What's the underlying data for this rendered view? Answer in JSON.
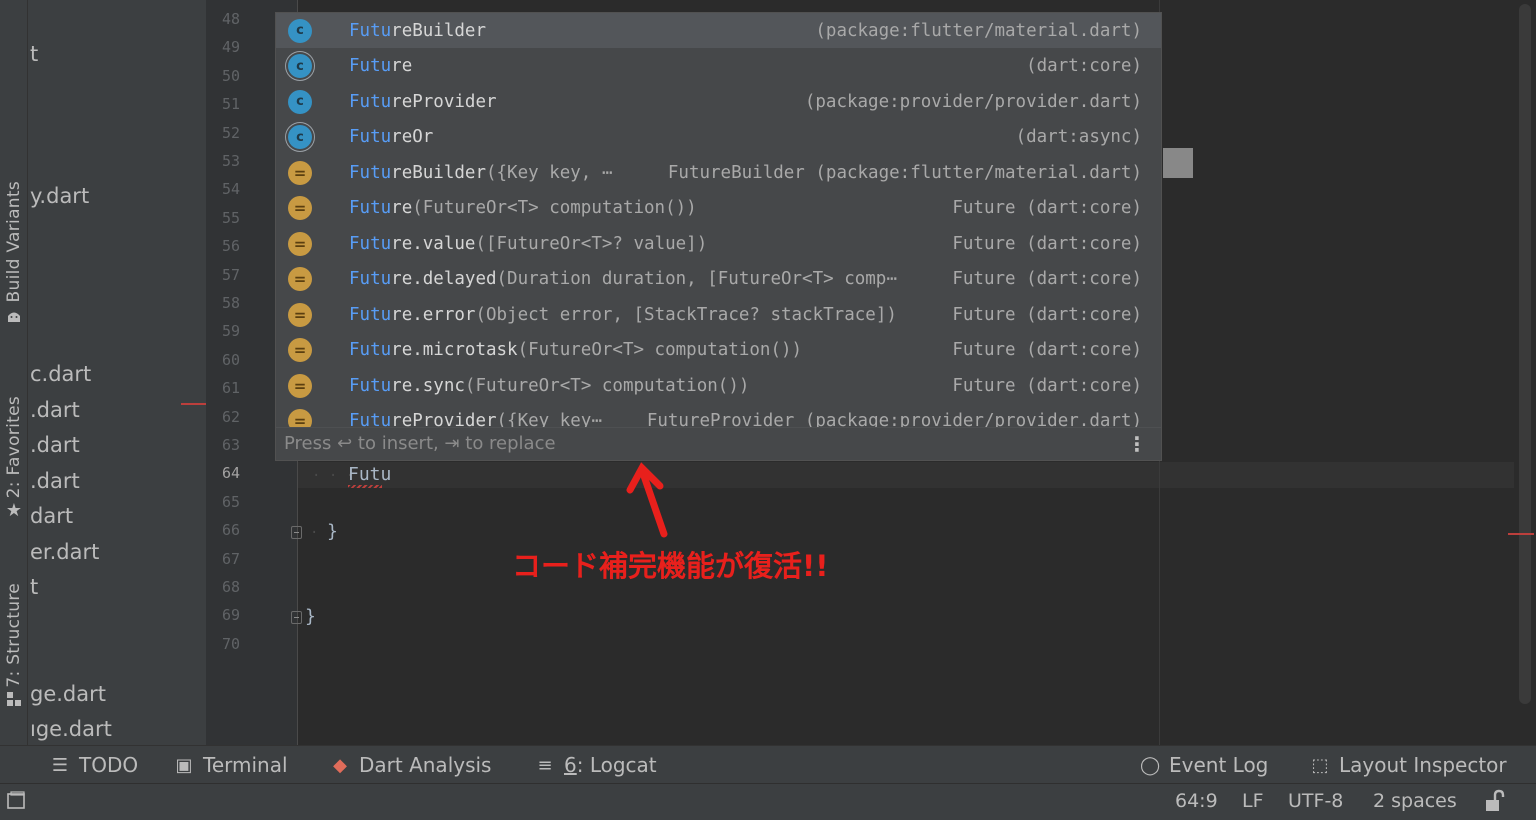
{
  "left_stripe": {
    "tabs": [
      {
        "label": "Build Variants",
        "icon": "android-icon"
      },
      {
        "label": "2: Favorites",
        "icon": "star-icon"
      },
      {
        "label": "7: Structure",
        "icon": "structure-icon"
      }
    ]
  },
  "project_panel": {
    "files": [
      "t",
      "y.dart",
      "c.dart",
      ".dart",
      ".dart",
      ".dart",
      "dart",
      "er.dart",
      "t",
      "ge.dart",
      "ıge.dart"
    ]
  },
  "editor": {
    "line_numbers": [
      "48",
      "49",
      "50",
      "51",
      "52",
      "53",
      "54",
      "55",
      "56",
      "57",
      "58",
      "59",
      "60",
      "61",
      "62",
      "63",
      "64",
      "65",
      "66",
      "67",
      "68",
      "69",
      "70"
    ],
    "current_line": "64",
    "typed_text": "Futu",
    "closing_brace_inner": "}",
    "closing_brace_outer": "}"
  },
  "completion_popup": {
    "items": [
      {
        "kind": "class",
        "icon": "class-icon",
        "match": "Futu",
        "rest": "reBuilder",
        "params": "",
        "type": "(package:flutter/material.dart)",
        "selected": true
      },
      {
        "kind": "abstract",
        "icon": "abstract-class-icon",
        "match": "Futu",
        "rest": "re",
        "params": "",
        "type": "(dart:core)",
        "selected": false
      },
      {
        "kind": "class",
        "icon": "class-icon",
        "match": "Futu",
        "rest": "reProvider",
        "params": "",
        "type": "(package:provider/provider.dart)",
        "selected": false
      },
      {
        "kind": "abstract",
        "icon": "abstract-class-icon",
        "match": "Futu",
        "rest": "reOr",
        "params": "",
        "type": "(dart:async)",
        "selected": false
      },
      {
        "kind": "method",
        "icon": "constructor-icon",
        "match": "Futu",
        "rest": "reBuilder",
        "params": "({Key key, ⋯",
        "type": "FutureBuilder (package:flutter/material.dart)",
        "selected": false
      },
      {
        "kind": "method",
        "icon": "constructor-icon",
        "match": "Futu",
        "rest": "re",
        "params": "(FutureOr<T> computation())",
        "type": "Future (dart:core)",
        "selected": false
      },
      {
        "kind": "method",
        "icon": "constructor-icon",
        "match": "Futu",
        "rest": "re.value",
        "params": "([FutureOr<T>? value])",
        "type": "Future (dart:core)",
        "selected": false
      },
      {
        "kind": "method",
        "icon": "constructor-icon",
        "match": "Futu",
        "rest": "re.delayed",
        "params": "(Duration duration, [FutureOr<T> comp⋯",
        "type": "Future (dart:core)",
        "selected": false
      },
      {
        "kind": "method",
        "icon": "constructor-icon",
        "match": "Futu",
        "rest": "re.error",
        "params": "(Object error, [StackTrace? stackTrace])",
        "type": "Future (dart:core)",
        "selected": false
      },
      {
        "kind": "method",
        "icon": "constructor-icon",
        "match": "Futu",
        "rest": "re.microtask",
        "params": "(FutureOr<T> computation())",
        "type": "Future (dart:core)",
        "selected": false
      },
      {
        "kind": "method",
        "icon": "constructor-icon",
        "match": "Futu",
        "rest": "re.sync",
        "params": "(FutureOr<T> computation())",
        "type": "Future (dart:core)",
        "selected": false
      },
      {
        "kind": "method",
        "icon": "constructor-icon",
        "match": "Futu",
        "rest": "reProvider",
        "params": "({Key key⋯",
        "type": "FutureProvider (package:provider/provider.dart)",
        "selected": false
      }
    ],
    "hint": "Press ↩ to insert, ⇥ to replace",
    "menu_icon": "⋮"
  },
  "annotation": {
    "text": "コード補完機能が復活!!",
    "color": "#e8201c"
  },
  "tool_windows": [
    {
      "icon": "list-icon",
      "glyph": "☰",
      "pre": "",
      "mnemonic": "",
      "label": "TODO"
    },
    {
      "icon": "terminal-icon",
      "glyph": "▣",
      "pre": "",
      "mnemonic": "",
      "label": "Terminal"
    },
    {
      "icon": "dart-analysis-icon",
      "glyph": "◆",
      "pre": "",
      "mnemonic": "",
      "label": "Dart Analysis"
    },
    {
      "icon": "logcat-icon",
      "glyph": "≡",
      "pre": "",
      "mnemonic": "6",
      "label": ": Logcat"
    },
    {
      "icon": "event-log-icon",
      "glyph": "◯",
      "pre": "",
      "mnemonic": "",
      "label": "Event Log"
    },
    {
      "icon": "layout-inspector-icon",
      "glyph": "⬚",
      "pre": "",
      "mnemonic": "",
      "label": "Layout Inspector"
    }
  ],
  "status_bar": {
    "position": "64:9",
    "line_separator": "LF",
    "encoding": "UTF-8",
    "indent": "2 spaces",
    "lock_icon": "unlock-icon"
  },
  "colors": {
    "match_highlight": "#589df6",
    "class_icon": "#3592c4",
    "method_icon": "#c89a42",
    "error": "#bc3f3c"
  }
}
